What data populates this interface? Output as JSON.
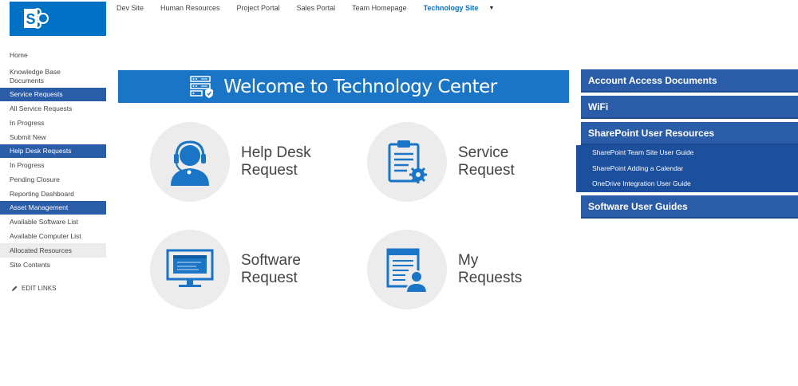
{
  "logo": {
    "alt": "S"
  },
  "top_nav": {
    "items": [
      {
        "label": "Dev Site"
      },
      {
        "label": "Human Resources"
      },
      {
        "label": "Project Portal"
      },
      {
        "label": "Sales Portal"
      },
      {
        "label": "Team Homepage"
      },
      {
        "label": "Technology Site",
        "active": true
      }
    ],
    "caret": "▼"
  },
  "left_nav": {
    "items": [
      {
        "label": "Home"
      },
      {
        "label": "Knowledge Base Documents"
      },
      {
        "label": "Service Requests",
        "header": true
      },
      {
        "label": "All Service Requests"
      },
      {
        "label": "In Progress"
      },
      {
        "label": "Submit New"
      },
      {
        "label": "Help Desk Requests",
        "header": true
      },
      {
        "label": "In Progress"
      },
      {
        "label": "Pending Closure"
      },
      {
        "label": "Reporting Dashboard"
      },
      {
        "label": "Asset Management",
        "header": true
      },
      {
        "label": "Available Software List"
      },
      {
        "label": "Available Computer List"
      },
      {
        "label": "Allocated Resources",
        "selected": true
      },
      {
        "label": "Site Contents"
      }
    ],
    "edit_links": "EDIT LINKS"
  },
  "welcome": {
    "title": "Welcome to Technology Center"
  },
  "tiles": [
    {
      "line1": "Help Desk",
      "line2": "Request",
      "icon": "headset-agent-icon"
    },
    {
      "line1": "Service",
      "line2": "Request",
      "icon": "clipboard-gear-icon"
    },
    {
      "line1": "Software",
      "line2": "Request",
      "icon": "monitor-window-icon"
    },
    {
      "line1": "My",
      "line2": "Requests",
      "icon": "document-user-icon"
    }
  ],
  "right_panel": {
    "account_access": "Account Access Documents",
    "wifi": "WiFi",
    "sharepoint_resources": "SharePoint User Resources",
    "sharepoint_links": [
      {
        "label": "SharePoint Team Site User Guide"
      },
      {
        "label": "SharePoint Adding a Calendar"
      },
      {
        "label": "OneDrive Integration User Guide"
      }
    ],
    "software_guides": "Software User Guides"
  },
  "colors": {
    "brand_blue": "#0072c6",
    "nav_header": "#2a5ca8",
    "banner": "#1a75c7",
    "tile_circle": "#ececec"
  }
}
